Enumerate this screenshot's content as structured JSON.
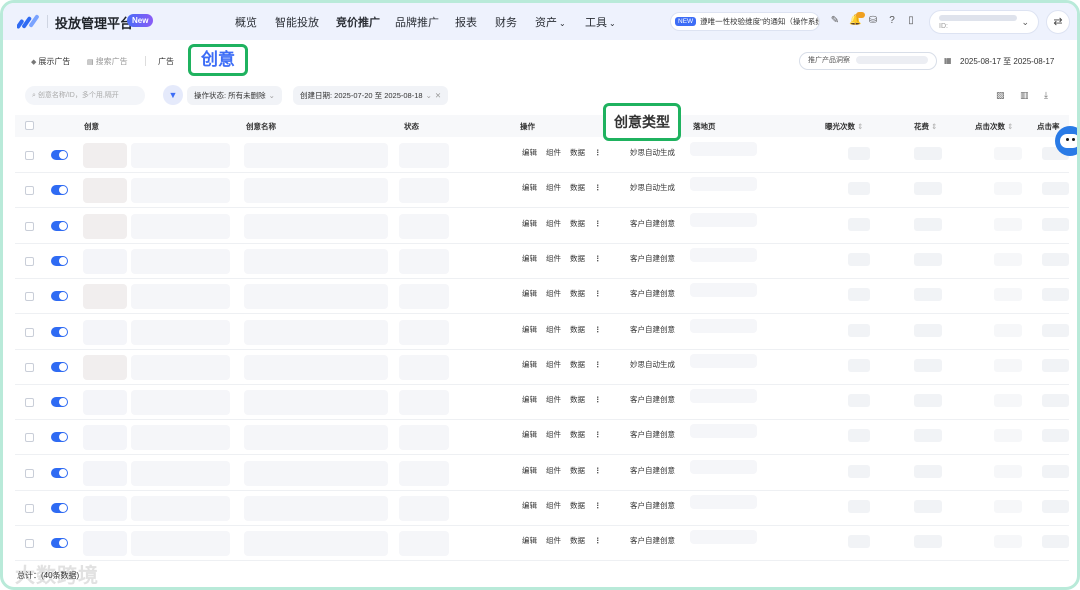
{
  "header": {
    "brand_title": "投放管理平台",
    "new_badge": "New",
    "menu": [
      {
        "label": "概览",
        "active": false,
        "dropdown": false
      },
      {
        "label": "智能投放",
        "active": false,
        "dropdown": false
      },
      {
        "label": "竞价推广",
        "active": true,
        "dropdown": false
      },
      {
        "label": "品牌推广",
        "active": false,
        "dropdown": false
      },
      {
        "label": "报表",
        "active": false,
        "dropdown": false
      },
      {
        "label": "财务",
        "active": false,
        "dropdown": false
      },
      {
        "label": "资产",
        "active": false,
        "dropdown": true
      },
      {
        "label": "工具",
        "active": false,
        "dropdown": true
      }
    ],
    "notice_badge": "NEW",
    "notice_text": "遵唯一性校验维度\"的通知（操作系统",
    "icons": [
      "edit-icon",
      "bell-icon",
      "database-icon",
      "help-icon",
      "mobile-icon"
    ],
    "account_id_label": "ID:",
    "switch_icon": "swap-icon"
  },
  "subnav": {
    "tab_display": "展示广告",
    "tab_search": "搜索广告",
    "tab_ads": "广告",
    "tab_creative": "创意",
    "promo_label": "推广产品洞察",
    "date_range": "2025-08-17 至 2025-08-17"
  },
  "filters": {
    "search_placeholder": "创意名称/ID，多个用,隔开",
    "chip_status": "操作状态: 所有未删除",
    "chip_date": "创建日期: 2025-07-20 至 2025-08-18"
  },
  "table": {
    "columns": {
      "creative": "创意",
      "creative_name": "创意名称",
      "status": "状态",
      "actions": "操作",
      "creative_type": "创意类型",
      "landing_page": "落地页",
      "impressions": "曝光次数",
      "cost": "花费",
      "clicks": "点击次数",
      "ctr": "点击率"
    },
    "action_labels": {
      "edit": "编辑",
      "component": "组件",
      "data": "数据"
    },
    "rows": [
      {
        "type": "妙思自动生成",
        "enabled": true
      },
      {
        "type": "妙思自动生成",
        "enabled": true
      },
      {
        "type": "客户自建创意",
        "enabled": true
      },
      {
        "type": "客户自建创意",
        "enabled": true
      },
      {
        "type": "客户自建创意",
        "enabled": true
      },
      {
        "type": "客户自建创意",
        "enabled": true
      },
      {
        "type": "妙思自动生成",
        "enabled": true
      },
      {
        "type": "客户自建创意",
        "enabled": true
      },
      {
        "type": "客户自建创意",
        "enabled": true
      },
      {
        "type": "客户自建创意",
        "enabled": true
      },
      {
        "type": "客户自建创意",
        "enabled": true
      },
      {
        "type": "客户自建创意",
        "enabled": true
      }
    ]
  },
  "footer": {
    "total": "总计：(40条数据)"
  },
  "watermark": "大数跨境",
  "colors": {
    "accent": "#2f6bf3",
    "highlight_border": "#1fb25f",
    "frame": "#b9ead9"
  }
}
